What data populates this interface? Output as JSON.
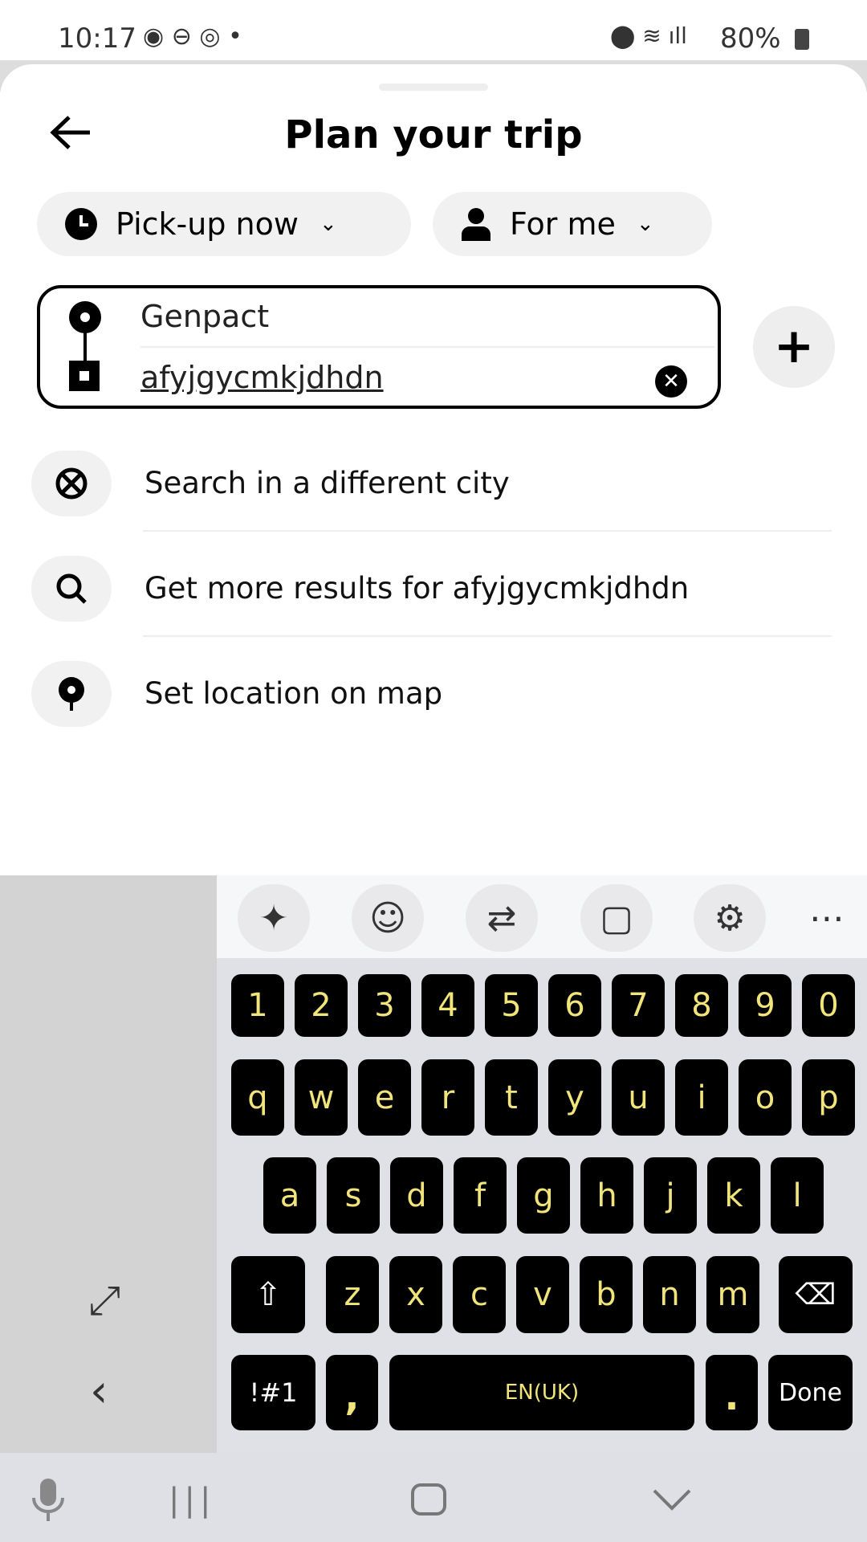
{
  "status_bar": {
    "time": "10:17",
    "battery": "80%",
    "icons": [
      "heart-circle-icon",
      "dnd-icon",
      "sync-icon",
      "dot-icon",
      "location-icon",
      "wifi-icon",
      "signal-icon",
      "battery-icon"
    ]
  },
  "header": {
    "title": "Plan your trip",
    "back_icon": "arrow-left-icon"
  },
  "chips": [
    {
      "label": "Pick-up now",
      "icon": "clock-icon"
    },
    {
      "label": "For me",
      "icon": "person-icon"
    }
  ],
  "route": {
    "pickup": "Genpact",
    "destination": "afyjgycmkjdhdn"
  },
  "results": [
    {
      "label": "Search in a different city",
      "icon": "globe-crossed-icon"
    },
    {
      "label": "Get more results for afyjgycmkjdhdn",
      "icon": "search-icon"
    },
    {
      "label": "Set location on map",
      "icon": "pin-icon"
    }
  ],
  "keyboard": {
    "toolbar": [
      "sparkle-icon",
      "emoji-icon",
      "translate-icon",
      "clipboard-icon",
      "settings-icon",
      "more-icon"
    ],
    "rows": [
      [
        "1",
        "2",
        "3",
        "4",
        "5",
        "6",
        "7",
        "8",
        "9",
        "0"
      ],
      [
        "q",
        "w",
        "e",
        "r",
        "t",
        "y",
        "u",
        "i",
        "o",
        "p"
      ],
      [
        "a",
        "s",
        "d",
        "f",
        "g",
        "h",
        "j",
        "k",
        "l"
      ],
      [
        "z",
        "x",
        "c",
        "v",
        "b",
        "n",
        "m"
      ]
    ],
    "symbols": "!#1",
    "comma": ",",
    "space": "EN(UK)",
    "period": ".",
    "done": "Done",
    "key_text_color": "#f1e47a"
  }
}
